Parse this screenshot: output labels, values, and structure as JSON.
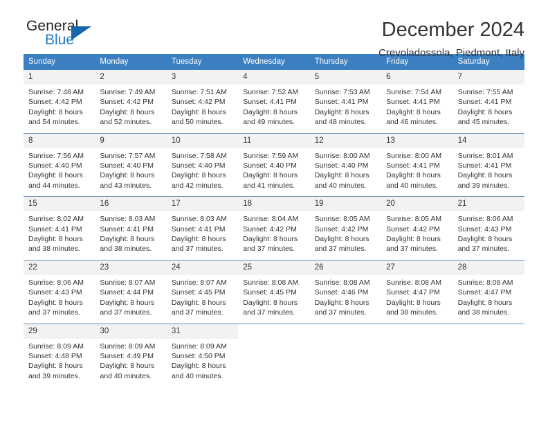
{
  "brand": {
    "name_top": "General",
    "name_bottom": "Blue",
    "accent_color": "#1665ae",
    "text_color": "#231f20"
  },
  "header": {
    "title": "December 2024",
    "subtitle": "Crevoladossola, Piedmont, Italy"
  },
  "calendar": {
    "header_bg": "#3c7fc1",
    "daynum_bg": "#f2f2f2",
    "weekdays": [
      "Sunday",
      "Monday",
      "Tuesday",
      "Wednesday",
      "Thursday",
      "Friday",
      "Saturday"
    ],
    "weeks": [
      [
        {
          "day": "1",
          "sunrise": "Sunrise: 7:48 AM",
          "sunset": "Sunset: 4:42 PM",
          "daylight1": "Daylight: 8 hours",
          "daylight2": "and 54 minutes."
        },
        {
          "day": "2",
          "sunrise": "Sunrise: 7:49 AM",
          "sunset": "Sunset: 4:42 PM",
          "daylight1": "Daylight: 8 hours",
          "daylight2": "and 52 minutes."
        },
        {
          "day": "3",
          "sunrise": "Sunrise: 7:51 AM",
          "sunset": "Sunset: 4:42 PM",
          "daylight1": "Daylight: 8 hours",
          "daylight2": "and 50 minutes."
        },
        {
          "day": "4",
          "sunrise": "Sunrise: 7:52 AM",
          "sunset": "Sunset: 4:41 PM",
          "daylight1": "Daylight: 8 hours",
          "daylight2": "and 49 minutes."
        },
        {
          "day": "5",
          "sunrise": "Sunrise: 7:53 AM",
          "sunset": "Sunset: 4:41 PM",
          "daylight1": "Daylight: 8 hours",
          "daylight2": "and 48 minutes."
        },
        {
          "day": "6",
          "sunrise": "Sunrise: 7:54 AM",
          "sunset": "Sunset: 4:41 PM",
          "daylight1": "Daylight: 8 hours",
          "daylight2": "and 46 minutes."
        },
        {
          "day": "7",
          "sunrise": "Sunrise: 7:55 AM",
          "sunset": "Sunset: 4:41 PM",
          "daylight1": "Daylight: 8 hours",
          "daylight2": "and 45 minutes."
        }
      ],
      [
        {
          "day": "8",
          "sunrise": "Sunrise: 7:56 AM",
          "sunset": "Sunset: 4:40 PM",
          "daylight1": "Daylight: 8 hours",
          "daylight2": "and 44 minutes."
        },
        {
          "day": "9",
          "sunrise": "Sunrise: 7:57 AM",
          "sunset": "Sunset: 4:40 PM",
          "daylight1": "Daylight: 8 hours",
          "daylight2": "and 43 minutes."
        },
        {
          "day": "10",
          "sunrise": "Sunrise: 7:58 AM",
          "sunset": "Sunset: 4:40 PM",
          "daylight1": "Daylight: 8 hours",
          "daylight2": "and 42 minutes."
        },
        {
          "day": "11",
          "sunrise": "Sunrise: 7:59 AM",
          "sunset": "Sunset: 4:40 PM",
          "daylight1": "Daylight: 8 hours",
          "daylight2": "and 41 minutes."
        },
        {
          "day": "12",
          "sunrise": "Sunrise: 8:00 AM",
          "sunset": "Sunset: 4:40 PM",
          "daylight1": "Daylight: 8 hours",
          "daylight2": "and 40 minutes."
        },
        {
          "day": "13",
          "sunrise": "Sunrise: 8:00 AM",
          "sunset": "Sunset: 4:41 PM",
          "daylight1": "Daylight: 8 hours",
          "daylight2": "and 40 minutes."
        },
        {
          "day": "14",
          "sunrise": "Sunrise: 8:01 AM",
          "sunset": "Sunset: 4:41 PM",
          "daylight1": "Daylight: 8 hours",
          "daylight2": "and 39 minutes."
        }
      ],
      [
        {
          "day": "15",
          "sunrise": "Sunrise: 8:02 AM",
          "sunset": "Sunset: 4:41 PM",
          "daylight1": "Daylight: 8 hours",
          "daylight2": "and 38 minutes."
        },
        {
          "day": "16",
          "sunrise": "Sunrise: 8:03 AM",
          "sunset": "Sunset: 4:41 PM",
          "daylight1": "Daylight: 8 hours",
          "daylight2": "and 38 minutes."
        },
        {
          "day": "17",
          "sunrise": "Sunrise: 8:03 AM",
          "sunset": "Sunset: 4:41 PM",
          "daylight1": "Daylight: 8 hours",
          "daylight2": "and 37 minutes."
        },
        {
          "day": "18",
          "sunrise": "Sunrise: 8:04 AM",
          "sunset": "Sunset: 4:42 PM",
          "daylight1": "Daylight: 8 hours",
          "daylight2": "and 37 minutes."
        },
        {
          "day": "19",
          "sunrise": "Sunrise: 8:05 AM",
          "sunset": "Sunset: 4:42 PM",
          "daylight1": "Daylight: 8 hours",
          "daylight2": "and 37 minutes."
        },
        {
          "day": "20",
          "sunrise": "Sunrise: 8:05 AM",
          "sunset": "Sunset: 4:42 PM",
          "daylight1": "Daylight: 8 hours",
          "daylight2": "and 37 minutes."
        },
        {
          "day": "21",
          "sunrise": "Sunrise: 8:06 AM",
          "sunset": "Sunset: 4:43 PM",
          "daylight1": "Daylight: 8 hours",
          "daylight2": "and 37 minutes."
        }
      ],
      [
        {
          "day": "22",
          "sunrise": "Sunrise: 8:06 AM",
          "sunset": "Sunset: 4:43 PM",
          "daylight1": "Daylight: 8 hours",
          "daylight2": "and 37 minutes."
        },
        {
          "day": "23",
          "sunrise": "Sunrise: 8:07 AM",
          "sunset": "Sunset: 4:44 PM",
          "daylight1": "Daylight: 8 hours",
          "daylight2": "and 37 minutes."
        },
        {
          "day": "24",
          "sunrise": "Sunrise: 8:07 AM",
          "sunset": "Sunset: 4:45 PM",
          "daylight1": "Daylight: 8 hours",
          "daylight2": "and 37 minutes."
        },
        {
          "day": "25",
          "sunrise": "Sunrise: 8:08 AM",
          "sunset": "Sunset: 4:45 PM",
          "daylight1": "Daylight: 8 hours",
          "daylight2": "and 37 minutes."
        },
        {
          "day": "26",
          "sunrise": "Sunrise: 8:08 AM",
          "sunset": "Sunset: 4:46 PM",
          "daylight1": "Daylight: 8 hours",
          "daylight2": "and 37 minutes."
        },
        {
          "day": "27",
          "sunrise": "Sunrise: 8:08 AM",
          "sunset": "Sunset: 4:47 PM",
          "daylight1": "Daylight: 8 hours",
          "daylight2": "and 38 minutes."
        },
        {
          "day": "28",
          "sunrise": "Sunrise: 8:08 AM",
          "sunset": "Sunset: 4:47 PM",
          "daylight1": "Daylight: 8 hours",
          "daylight2": "and 38 minutes."
        }
      ],
      [
        {
          "day": "29",
          "sunrise": "Sunrise: 8:09 AM",
          "sunset": "Sunset: 4:48 PM",
          "daylight1": "Daylight: 8 hours",
          "daylight2": "and 39 minutes."
        },
        {
          "day": "30",
          "sunrise": "Sunrise: 8:09 AM",
          "sunset": "Sunset: 4:49 PM",
          "daylight1": "Daylight: 8 hours",
          "daylight2": "and 40 minutes."
        },
        {
          "day": "31",
          "sunrise": "Sunrise: 8:09 AM",
          "sunset": "Sunset: 4:50 PM",
          "daylight1": "Daylight: 8 hours",
          "daylight2": "and 40 minutes."
        },
        {
          "day": "",
          "sunrise": "",
          "sunset": "",
          "daylight1": "",
          "daylight2": ""
        },
        {
          "day": "",
          "sunrise": "",
          "sunset": "",
          "daylight1": "",
          "daylight2": ""
        },
        {
          "day": "",
          "sunrise": "",
          "sunset": "",
          "daylight1": "",
          "daylight2": ""
        },
        {
          "day": "",
          "sunrise": "",
          "sunset": "",
          "daylight1": "",
          "daylight2": ""
        }
      ]
    ]
  }
}
